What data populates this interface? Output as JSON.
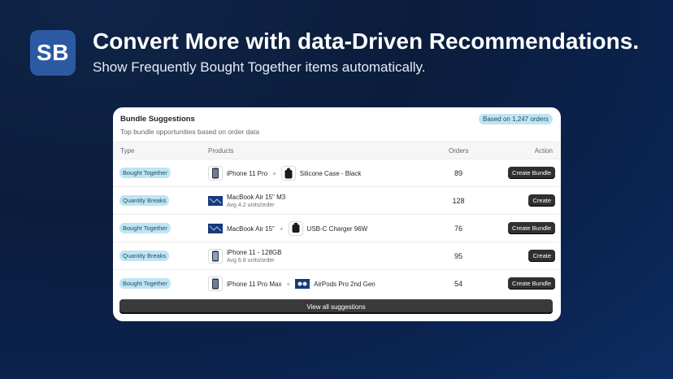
{
  "brand": {
    "logo_text": "SB",
    "logo_color": "#2b5aa3"
  },
  "hero": {
    "headline": "Convert More with data-Driven Recommendations.",
    "subline": "Show Frequently Bought Together items automatically."
  },
  "card": {
    "title": "Bundle Suggestions",
    "subtitle": "Top bundle opportunities based on order data",
    "badge": "Based on 1,247 orders",
    "columns": {
      "type": "Type",
      "products": "Products",
      "orders": "Orders",
      "action": "Action"
    },
    "rows": [
      {
        "type": "Bought Together",
        "product1": "iPhone 11 Pro",
        "product2": "Silicone Case - Black",
        "orders": "89",
        "action": "Create Bundle",
        "icon1": "iphone-icon",
        "icon2": "case-icon"
      },
      {
        "type": "Quantity Breaks",
        "product1": "MacBook Air 15\" M3",
        "detail": "Avg 4.2 units/order",
        "orders": "128",
        "action": "Create",
        "icon1": "macbook-icon"
      },
      {
        "type": "Bought Together",
        "product1": "MacBook Air 15\"",
        "product2": "USB-C Charger 96W",
        "orders": "76",
        "action": "Create Bundle",
        "icon1": "macbook-icon",
        "icon2": "charger-icon"
      },
      {
        "type": "Quantity Breaks",
        "product1": "iPhone 11 - 128GB",
        "detail": "Avg 6.8 units/order",
        "orders": "95",
        "action": "Create",
        "icon1": "iphone-icon"
      },
      {
        "type": "Bought Together",
        "product1": "iPhone 11 Pro Max",
        "product2": "AirPods Pro 2nd Gen",
        "orders": "54",
        "action": "Create Bundle",
        "icon1": "iphone-icon",
        "icon2": "airpods-icon"
      }
    ],
    "view_all": "View all suggestions",
    "plus": "+"
  }
}
